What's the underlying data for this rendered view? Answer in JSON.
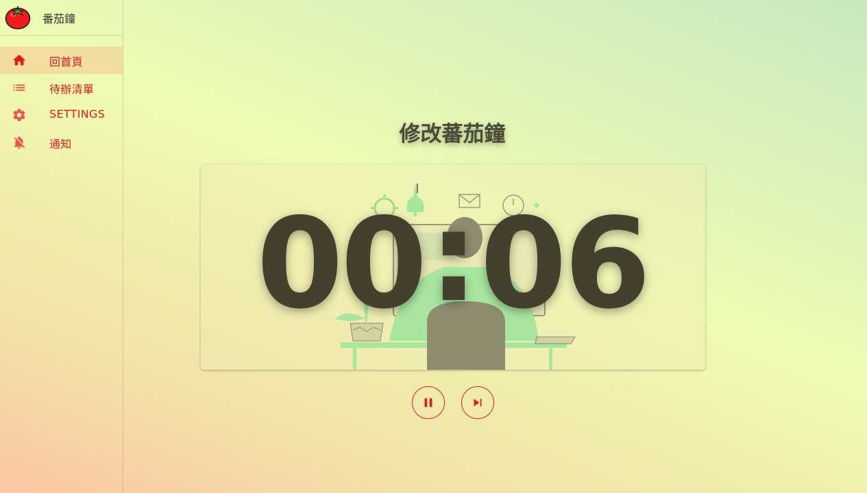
{
  "app": {
    "title": "番茄鐘"
  },
  "sidebar": {
    "items": [
      {
        "label": "回首頁",
        "icon": "home-icon",
        "active": true
      },
      {
        "label": "待辦清單",
        "icon": "list-icon",
        "active": false
      },
      {
        "label": "SETTINGS",
        "icon": "gear-icon",
        "active": false
      },
      {
        "label": "通知",
        "icon": "bell-off-icon",
        "active": false
      }
    ]
  },
  "main": {
    "title": "修改蕃茄鐘",
    "timer": {
      "minutes": "00",
      "separator": ":",
      "seconds": "06"
    },
    "controls": {
      "pause_icon": "pause-icon",
      "skip_icon": "skip-next-icon"
    }
  },
  "colors": {
    "accent": "#e8191e",
    "timer_text": "#43402e",
    "illustration_green": "#a8e6a0"
  }
}
